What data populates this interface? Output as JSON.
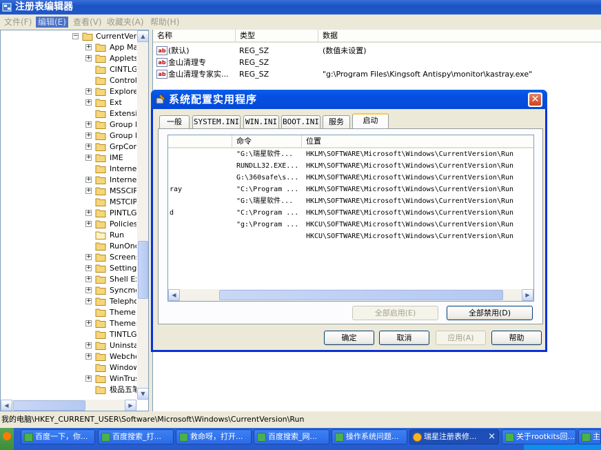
{
  "window": {
    "title": "注册表编辑器"
  },
  "menu": [
    {
      "label": "文件(F)"
    },
    {
      "label": "编辑(E)"
    },
    {
      "label": "查看(V)"
    },
    {
      "label": "收藏夹(A)"
    },
    {
      "label": "帮助(H)"
    }
  ],
  "tree": {
    "root_label": "CurrentVers",
    "items": [
      {
        "label": "App Mar",
        "expandable": true
      },
      {
        "label": "Applets",
        "expandable": true
      },
      {
        "label": "CINTLGI",
        "expandable": false
      },
      {
        "label": "Controls",
        "expandable": false
      },
      {
        "label": "Explorer",
        "expandable": true
      },
      {
        "label": "Ext",
        "expandable": true
      },
      {
        "label": "Extensic",
        "expandable": false
      },
      {
        "label": "Group P",
        "expandable": true
      },
      {
        "label": "Group P",
        "expandable": true
      },
      {
        "label": "GrpConv",
        "expandable": true
      },
      {
        "label": "IME",
        "expandable": true
      },
      {
        "label": "Internet",
        "expandable": false
      },
      {
        "label": "Internet",
        "expandable": true
      },
      {
        "label": "MSSCIPI",
        "expandable": true
      },
      {
        "label": "MSTCIPI",
        "expandable": false
      },
      {
        "label": "PINTLGI",
        "expandable": true
      },
      {
        "label": "Policies",
        "expandable": true
      },
      {
        "label": "Run",
        "expandable": false,
        "open": true
      },
      {
        "label": "RunOnc",
        "expandable": false
      },
      {
        "label": "Screens",
        "expandable": true
      },
      {
        "label": "Settings",
        "expandable": true
      },
      {
        "label": "Shell Ext",
        "expandable": true
      },
      {
        "label": "Syncmgr",
        "expandable": true
      },
      {
        "label": "Telepho",
        "expandable": true
      },
      {
        "label": "ThemeM",
        "expandable": false
      },
      {
        "label": "Themes",
        "expandable": true
      },
      {
        "label": "TINTLGI",
        "expandable": false
      },
      {
        "label": "Uninstal",
        "expandable": true
      },
      {
        "label": "Webche",
        "expandable": true
      },
      {
        "label": "Window",
        "expandable": false
      },
      {
        "label": "WinTrus",
        "expandable": true
      },
      {
        "label": "极品五笔",
        "expandable": false
      }
    ]
  },
  "values": {
    "headers": {
      "name": "名称",
      "type": "类型",
      "data": "数据"
    },
    "rows": [
      {
        "name": "(默认)",
        "type": "REG_SZ",
        "data": "(数值未设置)"
      },
      {
        "name": "金山清理专",
        "type": "REG_SZ",
        "data": ""
      },
      {
        "name": "金山清理专家实...",
        "type": "REG_SZ",
        "data": "\"g:\\Program Files\\Kingsoft Antispy\\monitor\\kastray.exe\""
      }
    ]
  },
  "status": {
    "path": "我的电脑\\HKEY_CURRENT_USER\\Software\\Microsoft\\Windows\\CurrentVersion\\Run"
  },
  "dialog": {
    "title": "系统配置实用程序",
    "tabs": [
      {
        "label": "一般"
      },
      {
        "label": "SYSTEM.INI"
      },
      {
        "label": "WIN.INI"
      },
      {
        "label": "BOOT.INI"
      },
      {
        "label": "服务"
      },
      {
        "label": "启动"
      }
    ],
    "startup": {
      "headers": {
        "item": "",
        "command": "命令",
        "location": "位置"
      },
      "rows": [
        {
          "item": "",
          "command": "\"G:\\瑞星软件...",
          "location": "HKLM\\SOFTWARE\\Microsoft\\Windows\\CurrentVersion\\Run"
        },
        {
          "item": "",
          "command": "RUNDLL32.EXE...",
          "location": "HKLM\\SOFTWARE\\Microsoft\\Windows\\CurrentVersion\\Run"
        },
        {
          "item": "",
          "command": "G:\\360safe\\s...",
          "location": "HKLM\\SOFTWARE\\Microsoft\\Windows\\CurrentVersion\\Run"
        },
        {
          "item": "ray",
          "command": "\"C:\\Program ...",
          "location": "HKLM\\SOFTWARE\\Microsoft\\Windows\\CurrentVersion\\Run"
        },
        {
          "item": "",
          "command": "\"G:\\瑞星软件...",
          "location": "HKLM\\SOFTWARE\\Microsoft\\Windows\\CurrentVersion\\Run"
        },
        {
          "item": "d",
          "command": "\"C:\\Program ...",
          "location": "HKLM\\SOFTWARE\\Microsoft\\Windows\\CurrentVersion\\Run"
        },
        {
          "item": "",
          "command": "\"g:\\Program ...",
          "location": "HKCU\\SOFTWARE\\Microsoft\\Windows\\CurrentVersion\\Run"
        },
        {
          "item": "",
          "command": "",
          "location": "HKCU\\SOFTWARE\\Microsoft\\Windows\\CurrentVersion\\Run"
        }
      ]
    },
    "enable_all": "全部启用(E)",
    "disable_all": "全部禁用(D)",
    "ok": "确定",
    "cancel": "取消",
    "apply": "应用(A)",
    "help": "帮助"
  },
  "taskbar": {
    "tasks": [
      {
        "label": "百度一下，你..."
      },
      {
        "label": "百度搜索_打..."
      },
      {
        "label": "救命呀，打开..."
      },
      {
        "label": "百度搜索_网..."
      },
      {
        "label": "操作系统问题..."
      },
      {
        "label": "瑞星注册表修..."
      },
      {
        "label": "关于rootkits回..."
      },
      {
        "label": "主"
      }
    ]
  },
  "colors": {
    "titlebar": "#1c53c4",
    "dialog_title": "#0551e2",
    "taskbar": "#245ccf",
    "selected_tab_accent": "#ffc83c"
  }
}
